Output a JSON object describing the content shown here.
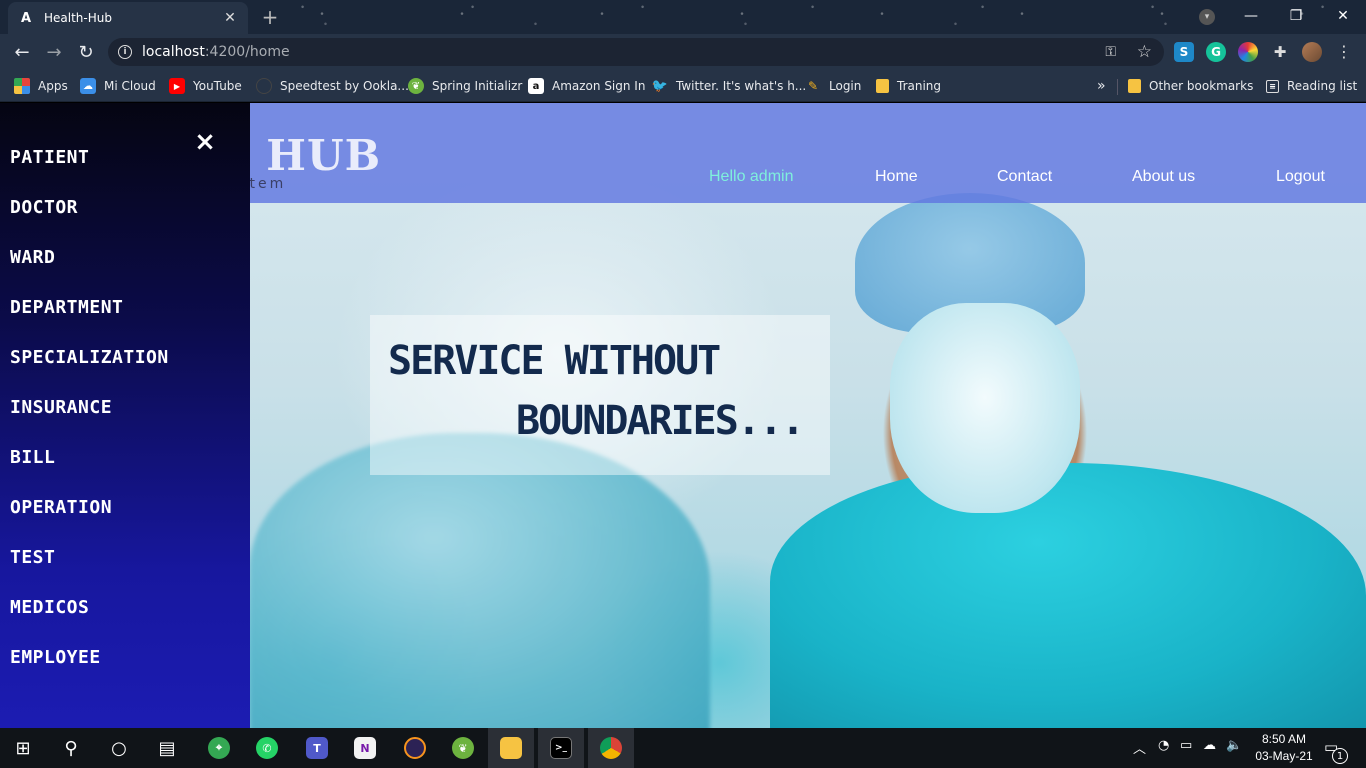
{
  "browser": {
    "tab_title": "Health-Hub",
    "tab_favicon": "A",
    "url_host": "localhost",
    "url_path": ":4200/home",
    "bookmarks": [
      {
        "label": "Apps",
        "icon": "apps-grid-icon",
        "color": "#e8453c"
      },
      {
        "label": "Mi Cloud",
        "icon": "mi-cloud-icon",
        "color": "#3b8fe8"
      },
      {
        "label": "YouTube",
        "icon": "youtube-icon",
        "color": "#ff0000"
      },
      {
        "label": "Speedtest by Ookla...",
        "icon": "speedtest-icon",
        "color": "#1c2433"
      },
      {
        "label": "Spring Initializr",
        "icon": "spring-icon",
        "color": "#6db33f"
      },
      {
        "label": "Amazon Sign In",
        "icon": "amazon-icon",
        "color": "#ffffff"
      },
      {
        "label": "Twitter. It's what's h...",
        "icon": "twitter-icon",
        "color": "#1da1f2"
      },
      {
        "label": "Login",
        "icon": "login-icon",
        "color": "#f2b01e"
      },
      {
        "label": "Traning",
        "icon": "folder-icon",
        "color": "#f6c342"
      }
    ],
    "other_bookmarks": "Other bookmarks",
    "reading_list": "Reading list",
    "overflow": "»"
  },
  "header": {
    "logo": "H HUB",
    "logo_sub": "ment System",
    "nav": {
      "greeting": "Hello admin",
      "home": "Home",
      "contact": "Contact",
      "about": "About us",
      "logout": "Logout"
    }
  },
  "hero": {
    "line1": "SERVICE WITHOUT",
    "line2": "BOUNDARIES..."
  },
  "sidenav": {
    "close": "×",
    "items": [
      "PATIENT",
      "DOCTOR",
      "WARD",
      "DEPARTMENT",
      "SPECIALIZATION",
      "INSURANCE",
      "BILL",
      "OPERATION",
      "TEST",
      "MEDICOS",
      "EMPLOYEE"
    ]
  },
  "taskbar": {
    "time": "8:50 AM",
    "date": "03-May-21",
    "notification_count": "1"
  }
}
